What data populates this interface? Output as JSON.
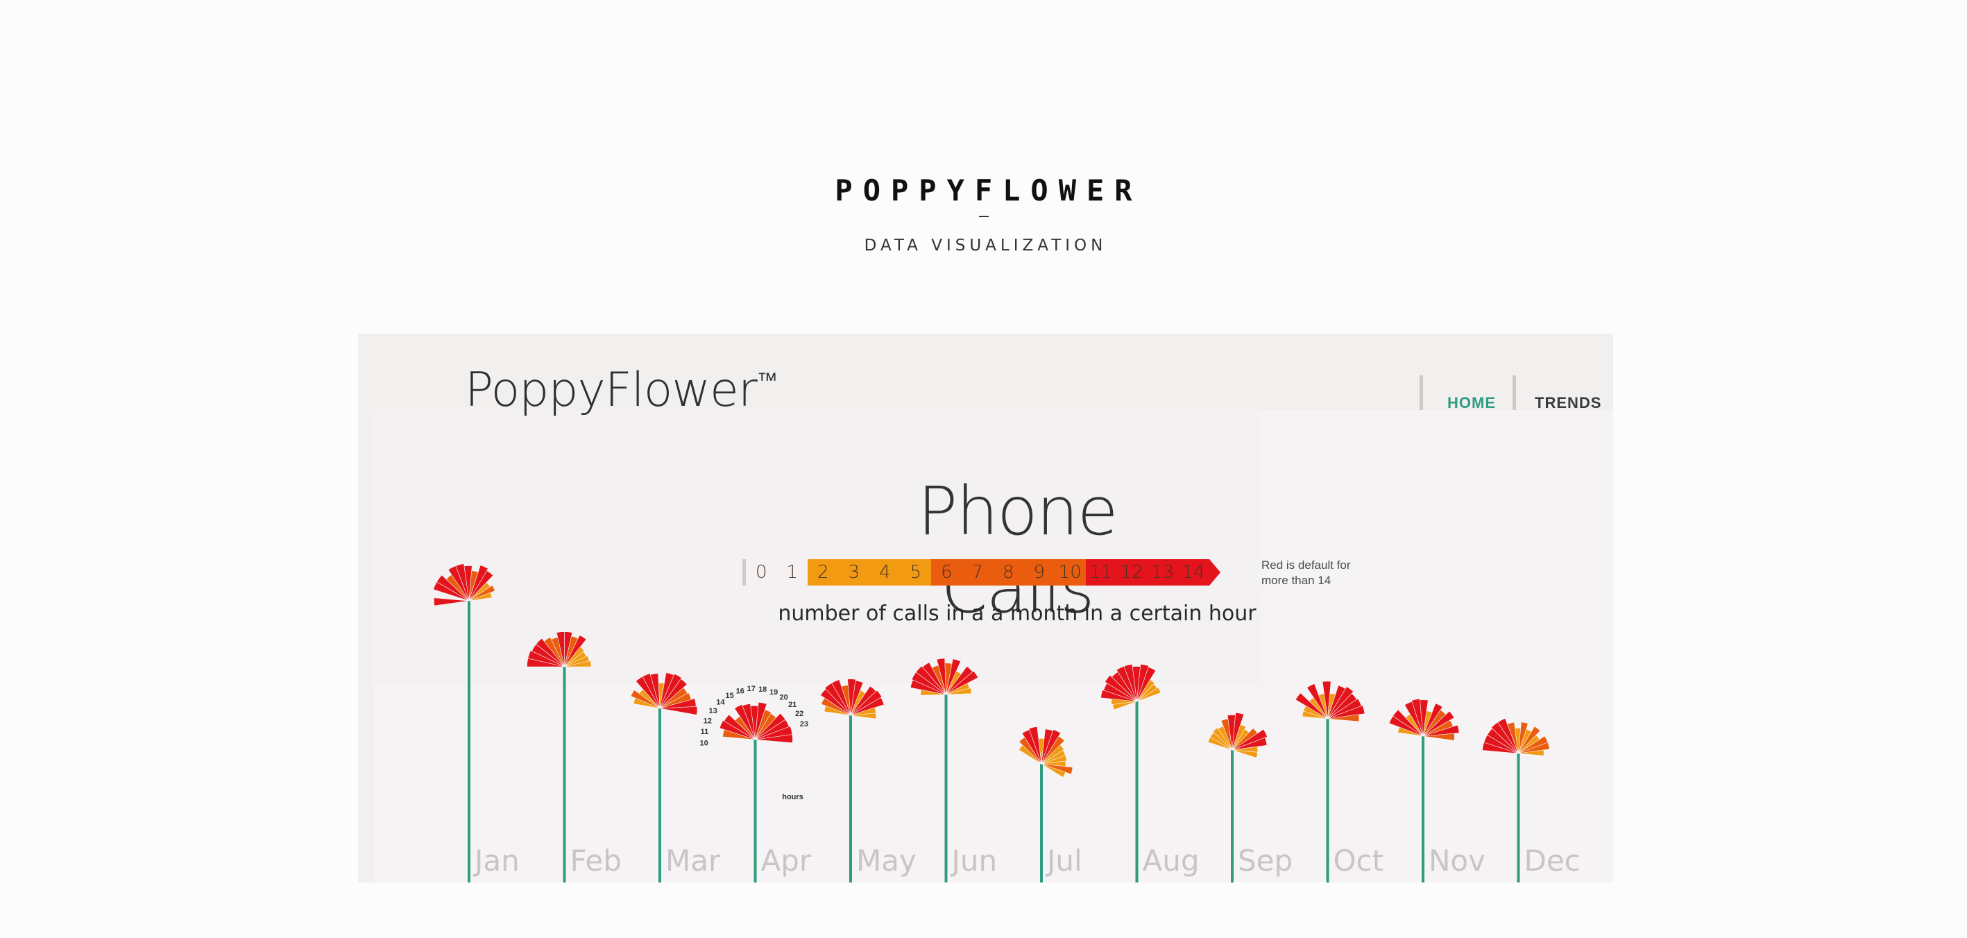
{
  "header": {
    "title": "POPPYFLOWER",
    "subtitle": "DATA VISUALIZATION"
  },
  "app": {
    "logo": "PoppyFlower",
    "logo_tm": "™",
    "nav": [
      {
        "label": "HOME",
        "active": true
      },
      {
        "label": "TRENDS",
        "active": false
      }
    ]
  },
  "chart": {
    "title": "Phone Calls",
    "subtitle": "number of calls in a  a month in a certain hour",
    "scale_note": "Red is default for more than 14",
    "colors": {
      "stem": "#2e9c80",
      "bin_0_1": "#f5f1f2",
      "bin_2_5": "#f29a12",
      "bin_6_10": "#ea5c0e",
      "bin_11_plus": "#e3141c",
      "month_label": "#c9c5c6"
    },
    "scale": [
      {
        "label": "0",
        "bin": "bin_0_1"
      },
      {
        "label": "1",
        "bin": "bin_0_1"
      },
      {
        "label": "2",
        "bin": "bin_2_5"
      },
      {
        "label": "3",
        "bin": "bin_2_5"
      },
      {
        "label": "4",
        "bin": "bin_2_5"
      },
      {
        "label": "5",
        "bin": "bin_2_5"
      },
      {
        "label": "6",
        "bin": "bin_6_10"
      },
      {
        "label": "7",
        "bin": "bin_6_10"
      },
      {
        "label": "8",
        "bin": "bin_6_10"
      },
      {
        "label": "9",
        "bin": "bin_6_10"
      },
      {
        "label": "10",
        "bin": "bin_6_10"
      },
      {
        "label": "11",
        "bin": "bin_11_plus"
      },
      {
        "label": "12",
        "bin": "bin_11_plus"
      },
      {
        "label": "13",
        "bin": "bin_11_plus"
      },
      {
        "label": "14",
        "bin": "bin_11_plus"
      }
    ],
    "hour_labels": [
      "10",
      "11",
      "12",
      "13",
      "14",
      "15",
      "16",
      "17",
      "18",
      "19",
      "20",
      "21",
      "22",
      "23"
    ],
    "hours_caption": "hours"
  },
  "chart_data": {
    "type": "radial-bar",
    "title": "Phone Calls",
    "subtitle": "number of calls in a  a month in a certain hour",
    "hours": [
      10,
      11,
      12,
      13,
      14,
      15,
      16,
      17,
      18,
      19,
      20,
      21,
      22,
      23
    ],
    "months": [
      {
        "month": "Jan",
        "calls": [
          12,
          1,
          14,
          14,
          9,
          14,
          14,
          12,
          8,
          14,
          12,
          4,
          6,
          2
        ]
      },
      {
        "month": "Feb",
        "calls": [
          14,
          14,
          13,
          13,
          10,
          8,
          12,
          12,
          9,
          12,
          4,
          3,
          4,
          5
        ]
      },
      {
        "month": "Mar",
        "calls": [
          5,
          9,
          4,
          13,
          13,
          12,
          4,
          13,
          14,
          13,
          9,
          10,
          13,
          14
        ]
      },
      {
        "month": "Apr",
        "calls": [
          10,
          14,
          13,
          6,
          14,
          13,
          11,
          14,
          9,
          8,
          13,
          13,
          14,
          14
        ]
      },
      {
        "month": "May",
        "calls": [
          5,
          9,
          13,
          14,
          14,
          8,
          13,
          12,
          5,
          12,
          13,
          12,
          4,
          4
        ]
      },
      {
        "month": "Jun",
        "calls": [
          4,
          13,
          14,
          14,
          13,
          8,
          13,
          9,
          13,
          4,
          12,
          13,
          3,
          4
        ]
      },
      {
        "month": "Jul",
        "calls": [
          5,
          9,
          13,
          14,
          4,
          12,
          13,
          10,
          5,
          4,
          4,
          3,
          9,
          4
        ]
      },
      {
        "month": "Aug",
        "calls": [
          3,
          4,
          13,
          12,
          14,
          12,
          14,
          14,
          12,
          14,
          13,
          4,
          3,
          4
        ]
      },
      {
        "month": "Sep",
        "calls": [
          4,
          4,
          5,
          4,
          9,
          12,
          14,
          5,
          3,
          8,
          14,
          12,
          4,
          4
        ]
      },
      {
        "month": "Oct",
        "calls": [
          4,
          4,
          14,
          4,
          14,
          4,
          14,
          4,
          12,
          14,
          12,
          13,
          14,
          9
        ]
      },
      {
        "month": "Nov",
        "calls": [
          4,
          13,
          13,
          4,
          13,
          14,
          13,
          4,
          12,
          9,
          13,
          9,
          13,
          9
        ]
      },
      {
        "month": "Dec",
        "calls": [
          13,
          13,
          13,
          14,
          14,
          9,
          4,
          9,
          4,
          9,
          4,
          9,
          9,
          4
        ]
      }
    ]
  }
}
